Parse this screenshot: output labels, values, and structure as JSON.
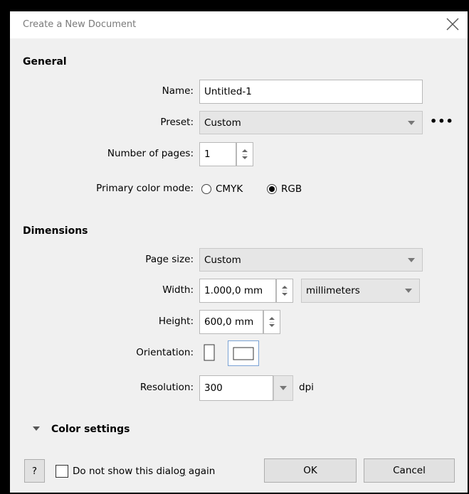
{
  "window": {
    "title": "Create a New Document"
  },
  "general": {
    "heading": "General",
    "name_label": "Name:",
    "name_value": "Untitled-1",
    "preset_label": "Preset:",
    "preset_value": "Custom",
    "more_label": "•••",
    "pages_label": "Number of pages:",
    "pages_value": "1",
    "color_mode_label": "Primary color mode:",
    "cmyk_label": "CMYK",
    "rgb_label": "RGB",
    "selected_mode": "RGB"
  },
  "dimensions": {
    "heading": "Dimensions",
    "page_size_label": "Page size:",
    "page_size_value": "Custom",
    "width_label": "Width:",
    "width_value": "1.000,0 mm",
    "units_value": "millimeters",
    "height_label": "Height:",
    "height_value": "600,0 mm",
    "orientation_label": "Orientation:",
    "orientation_selected": "landscape",
    "resolution_label": "Resolution:",
    "resolution_value": "300",
    "resolution_unit": "dpi"
  },
  "color_settings": {
    "label": "Color settings"
  },
  "footer": {
    "help_label": "?",
    "dont_show_pre": "Do not show this dialo",
    "dont_show_accel": "g",
    "dont_show_post": " again",
    "ok_label": "OK",
    "cancel_label": "Cancel"
  }
}
